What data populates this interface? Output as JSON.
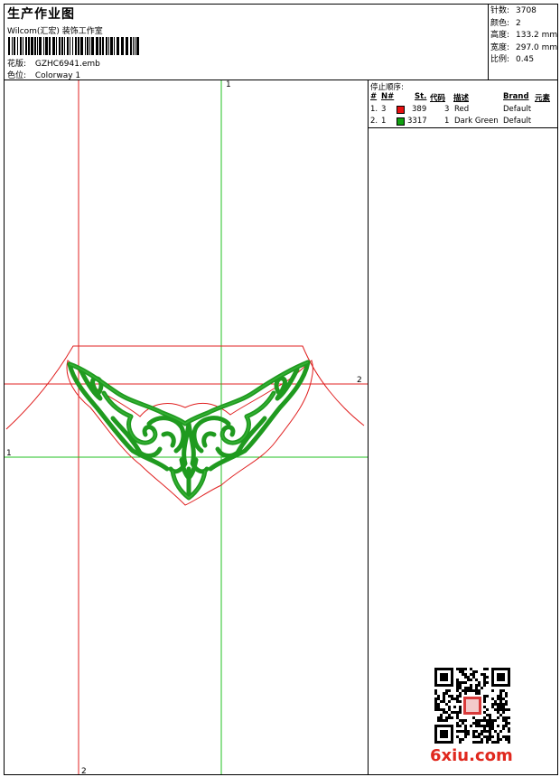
{
  "header": {
    "title": "生产作业图",
    "subtitle": "Wilcom(汇宏) 装饰工作室",
    "pattern_label": "花版:",
    "pattern_value": "GZHC6941.emb",
    "colorway_label": "色位:",
    "colorway_value": "Colorway 1"
  },
  "stats": {
    "stitches_label": "针数:",
    "stitches_value": "3708",
    "colors_label": "颜色:",
    "colors_value": "2",
    "height_label": "高度:",
    "height_value": "133.2 mm",
    "width_label": "宽度:",
    "width_value": "297.0 mm",
    "scale_label": "比例:",
    "scale_value": "0.45"
  },
  "design": {
    "marker_1_top": "1",
    "marker_1_left": "1",
    "marker_2_right": "2",
    "marker_2_bottom": "2",
    "colors": {
      "red_guide": "#e02020",
      "green_guide": "#20c020",
      "stitch_green": "#1f9a1f"
    }
  },
  "stop_sequence": {
    "title": "停止顺序:",
    "headers": {
      "num": "#",
      "needle": "N#",
      "stitches": "St.",
      "code": "代码",
      "desc": "描述",
      "brand": "Brand",
      "element": "元素"
    },
    "rows": [
      {
        "num": "1.",
        "needle": "3",
        "color": "#e81010",
        "stitches": "389",
        "code": "3",
        "desc": "Red",
        "brand": "Default"
      },
      {
        "num": "2.",
        "needle": "1",
        "color": "#10a010",
        "stitches": "3317",
        "code": "1",
        "desc": "Dark Green",
        "brand": "Default"
      }
    ]
  },
  "watermark": {
    "text": "6xiu.com",
    "color": "#e0281e"
  }
}
